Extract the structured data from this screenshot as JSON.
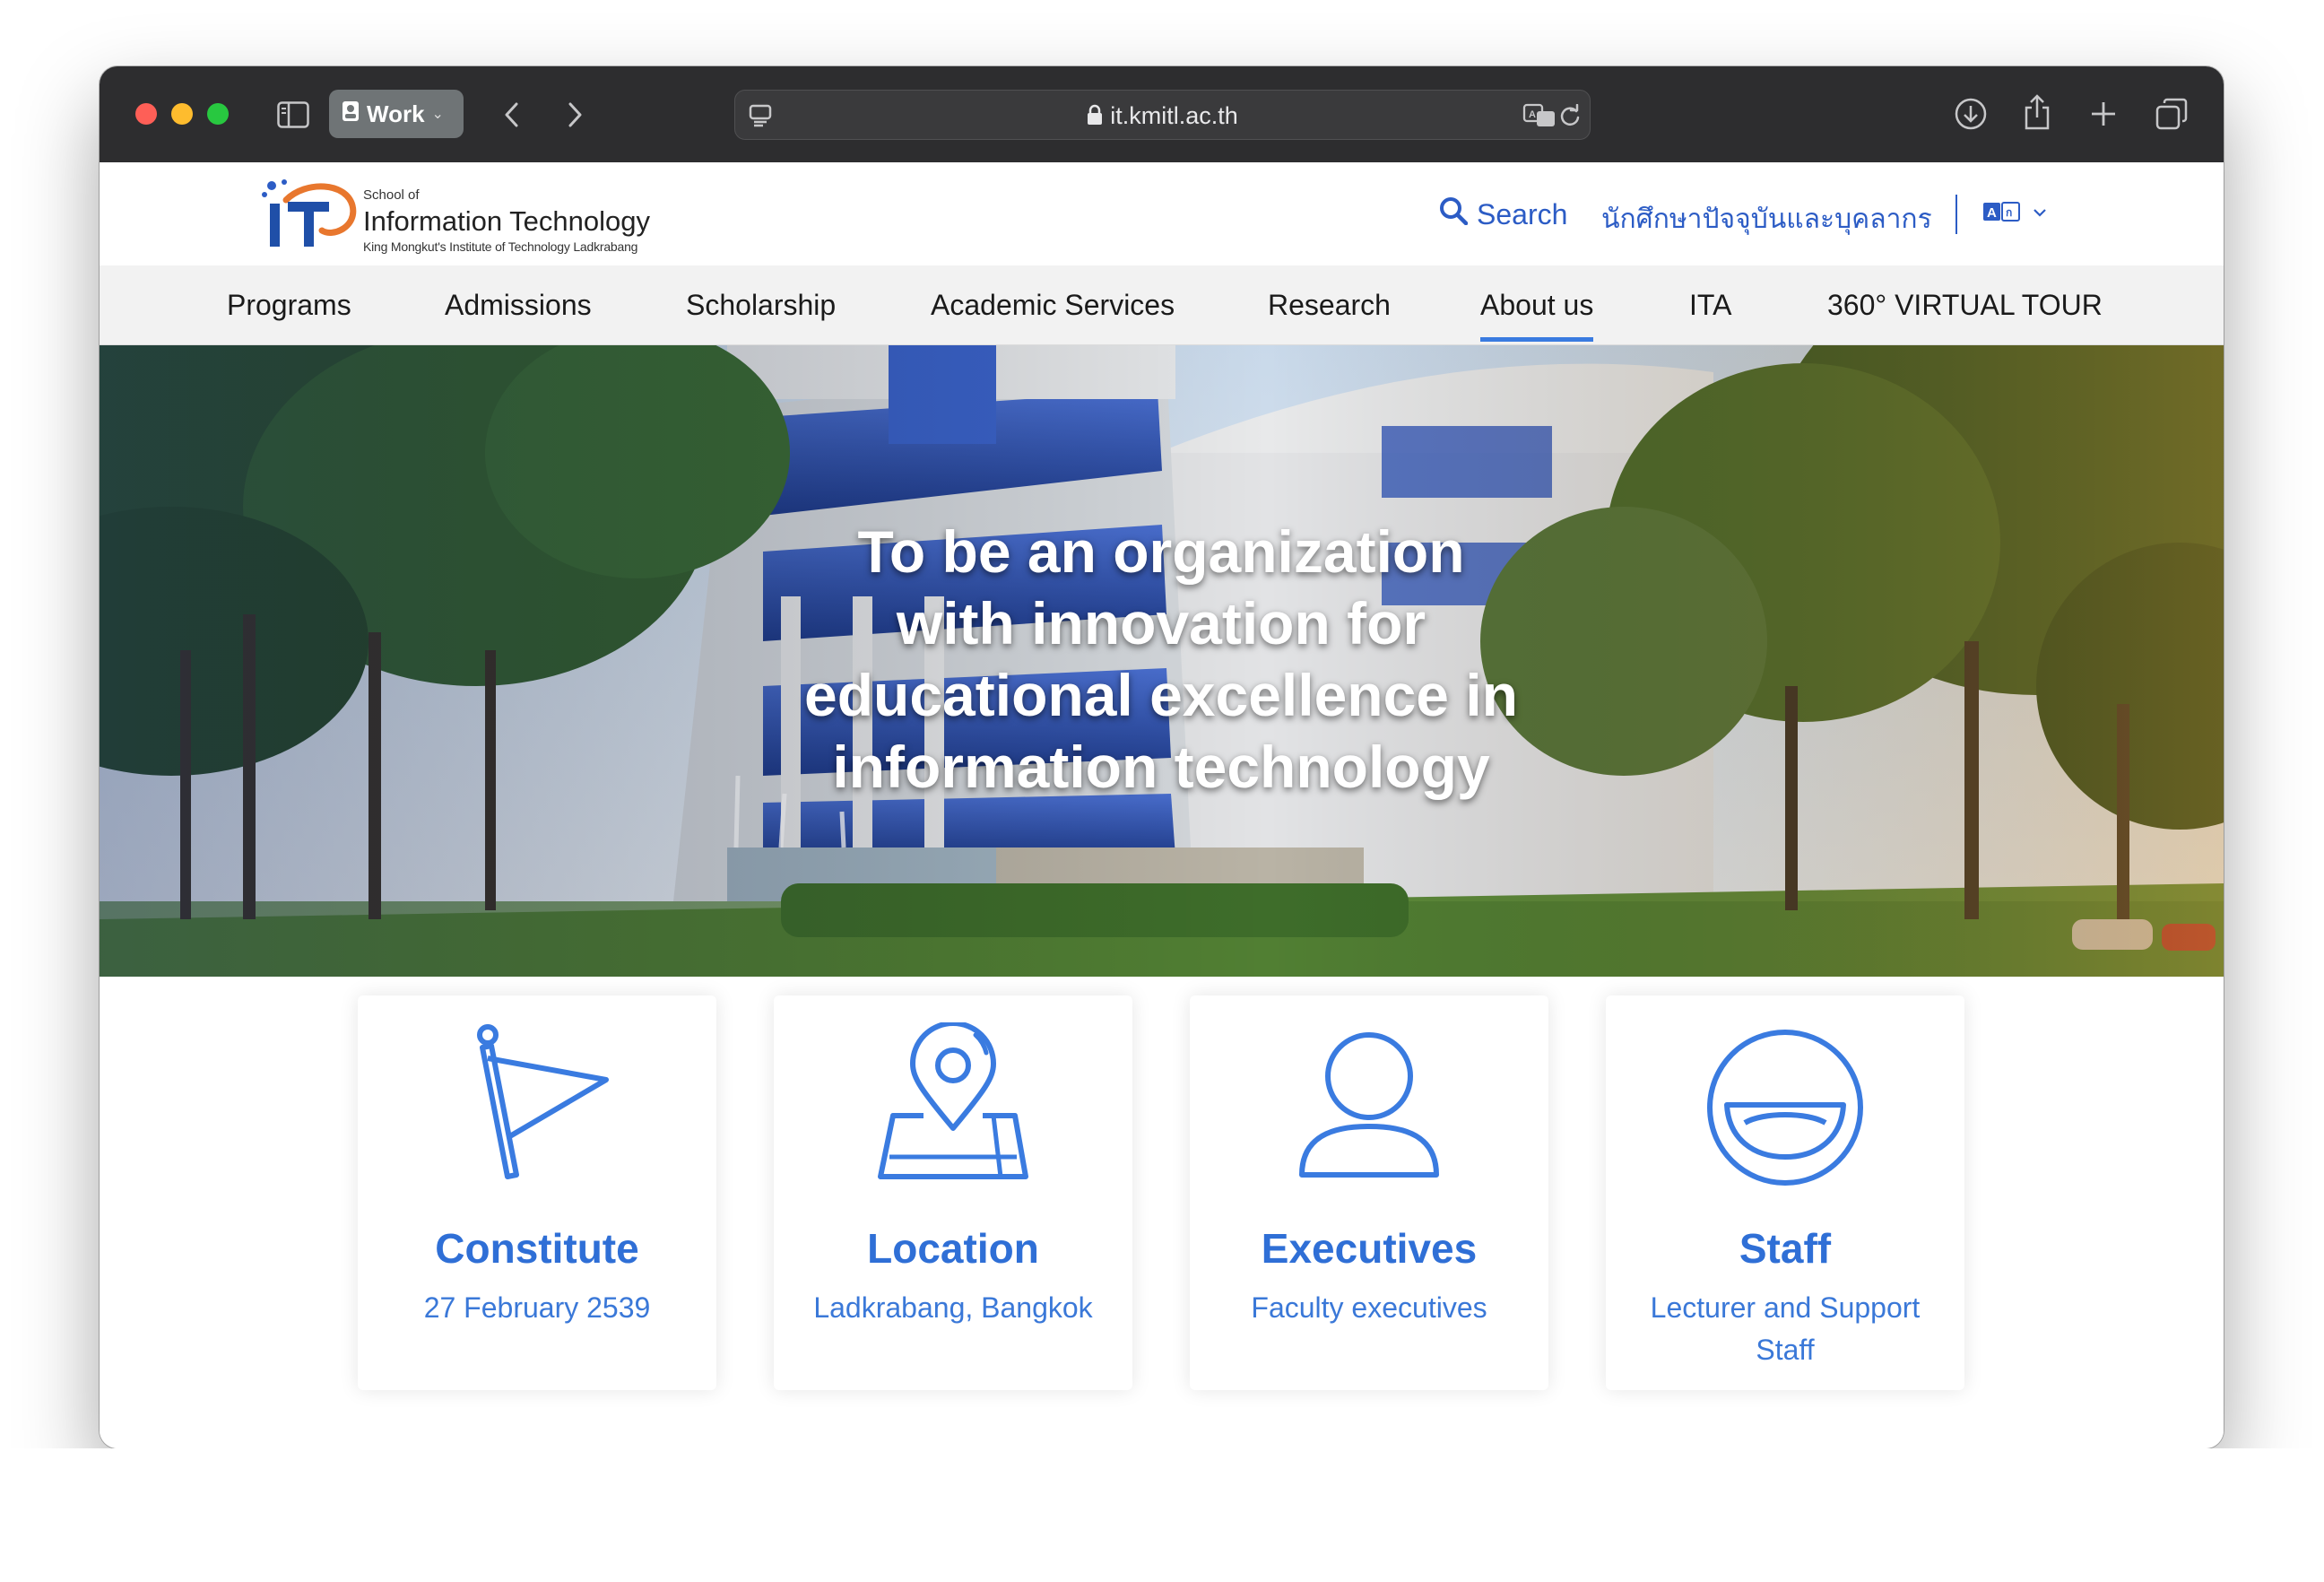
{
  "browser": {
    "profile_label": "Work",
    "url": "it.kmitl.ac.th"
  },
  "site": {
    "logo": {
      "small": "School of",
      "big": "Information Technology",
      "sub": "King Mongkut's Institute of Technology Ladkrabang"
    },
    "search_label": "Search",
    "thai_link": "นักศึกษาปัจจุบันและบุคลากร",
    "nav": [
      {
        "label": "Programs"
      },
      {
        "label": "Admissions"
      },
      {
        "label": "Scholarship"
      },
      {
        "label": "Academic Services"
      },
      {
        "label": "Research"
      },
      {
        "label": "About us"
      },
      {
        "label": "ITA"
      },
      {
        "label": "360° VIRTUAL TOUR"
      }
    ],
    "active_nav": "About us",
    "hero_text": "To be an organization with innovation for educational excellence in information technology",
    "cards": [
      {
        "title": "Constitute",
        "subtitle": "27 February 2539",
        "icon": "flag-icon"
      },
      {
        "title": "Location",
        "subtitle": "Ladkrabang, Bangkok",
        "icon": "map-pin-icon"
      },
      {
        "title": "Executives",
        "subtitle": "Faculty executives",
        "icon": "person-icon"
      },
      {
        "title": "Staff",
        "subtitle": "Lecturer and Support Staff",
        "icon": "smile-icon"
      }
    ]
  },
  "colors": {
    "accent": "#2f6fd6",
    "nav_underline": "#3a7be0",
    "toolbar": "#2d2d2f"
  }
}
